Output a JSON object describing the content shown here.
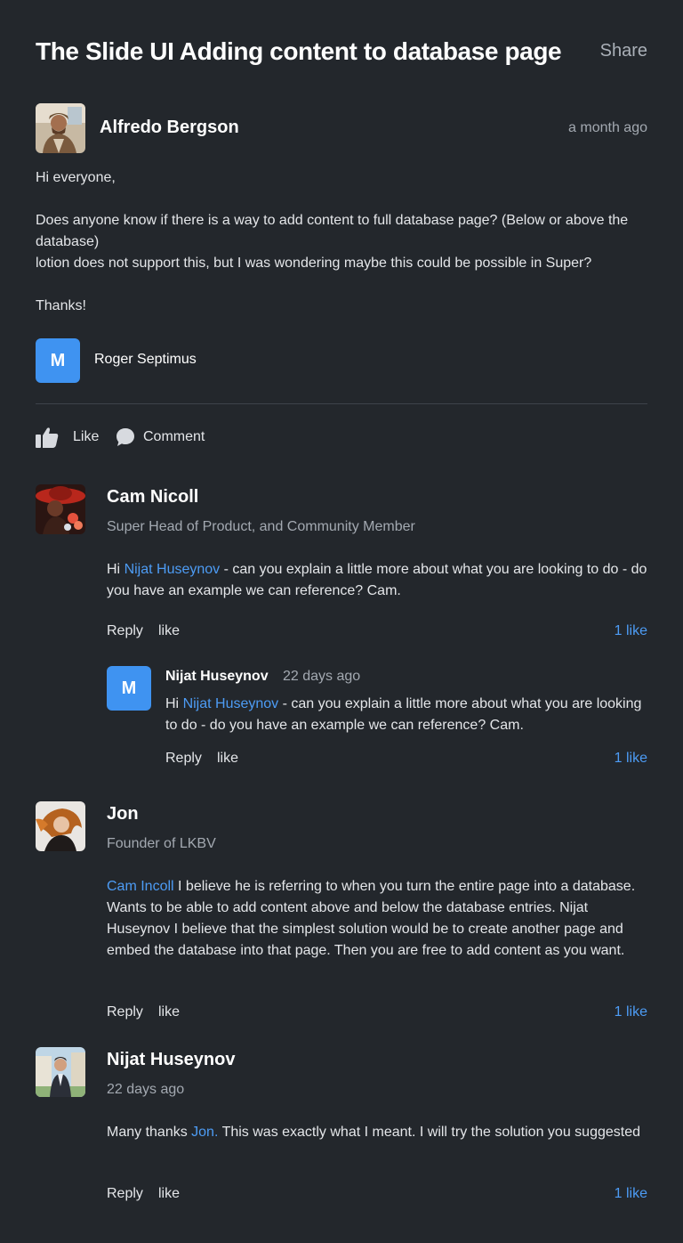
{
  "header": {
    "title": "The Slide UI Adding content to database page",
    "share_label": "Share"
  },
  "post": {
    "author": "Alfredo Bergson",
    "time": "a month ago",
    "body": {
      "greeting": "Hi everyone,",
      "line1": "Does anyone know if there is a way to add content to full database page? (Below or above the database)",
      "line2": "lotion does not support this, but I was wondering maybe this could be possible in Super?",
      "closing": "Thanks!"
    },
    "participant": {
      "initial": "M",
      "name": "Roger Septimus"
    },
    "actions": {
      "like_label": "Like",
      "comment_label": "Comment"
    }
  },
  "comments": [
    {
      "author": "Cam Nicoll",
      "subtitle": "Super Head of Product, and Community Member",
      "text_prefix": "Hi ",
      "mention": "Nijat Huseynov",
      "text": " - can you explain a little more about what you are looking to do - do you have an example we can reference? Cam.",
      "reply_label": "Reply",
      "like_label": "like",
      "likes": "1 like",
      "reply": {
        "initial": "M",
        "author": "Nijat Huseynov",
        "time": "22 days ago",
        "text_prefix": "Hi ",
        "mention": "Nijat Huseynov",
        "text": " - can you explain a little more about what you are looking to do - do you have an example we can reference? Cam.",
        "reply_label": "Reply",
        "like_label": "like",
        "likes": "1 like"
      }
    },
    {
      "author": "Jon",
      "subtitle": "Founder of LKBV",
      "mention": "Cam Incoll",
      "text": " I believe he is referring to when you turn the entire page into a database. Wants to be able to add content above and below the database entries. Nijat Huseynov I believe that the simplest solution would be to create another page and embed the database into that page. Then you are free to add content as you want.",
      "reply_label": "Reply",
      "like_label": "like",
      "likes": "1 like"
    },
    {
      "author": "Nijat Huseynov",
      "subtitle": "22 days ago",
      "text_prefix": "Many thanks ",
      "mention": "Jon.",
      "text": " This was exactly what I meant. I will try the solution you suggested",
      "reply_label": "Reply",
      "like_label": "like",
      "likes": "1 like"
    }
  ],
  "colors": {
    "background": "#23272c",
    "accent": "#3f93f1",
    "link": "#4d9cf5",
    "muted": "#a3a9b1"
  }
}
